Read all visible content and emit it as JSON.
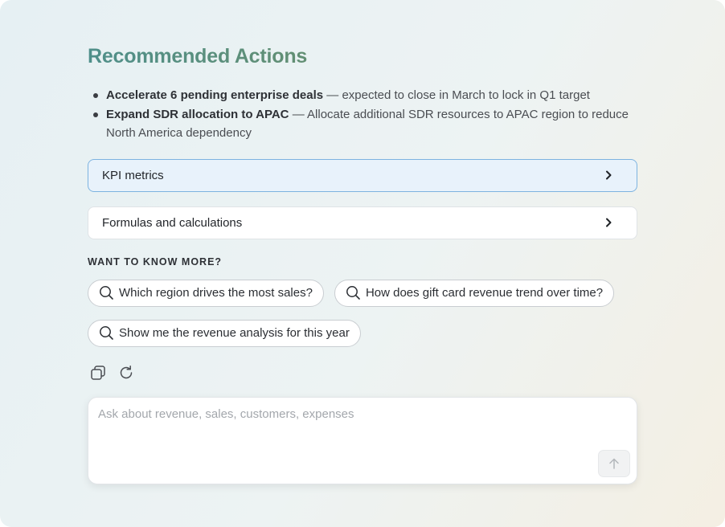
{
  "title": "Recommended Actions",
  "bullets": [
    {
      "bold": "Accelerate 6 pending enterprise deals",
      "rest": " — expected to close in March to lock in Q1 target"
    },
    {
      "bold": "Expand SDR allocation to APAC",
      "rest": " — Allocate additional SDR resources to APAC region to reduce North America dependency"
    }
  ],
  "accordions": [
    {
      "label": "KPI metrics",
      "active": true
    },
    {
      "label": "Formulas and calculations",
      "active": false
    }
  ],
  "more_label": "WANT TO KNOW MORE?",
  "suggestions": [
    "Which region drives the most sales?",
    "How does gift card revenue trend over time?",
    "Show me the revenue analysis for this year"
  ],
  "composer": {
    "placeholder": "Ask about revenue, sales, customers, expenses",
    "value": ""
  },
  "icons": {
    "copy": "copy-icon",
    "regenerate": "refresh-icon",
    "search": "search-icon",
    "chevron": "chevron-right-icon",
    "send": "arrow-up-icon"
  }
}
